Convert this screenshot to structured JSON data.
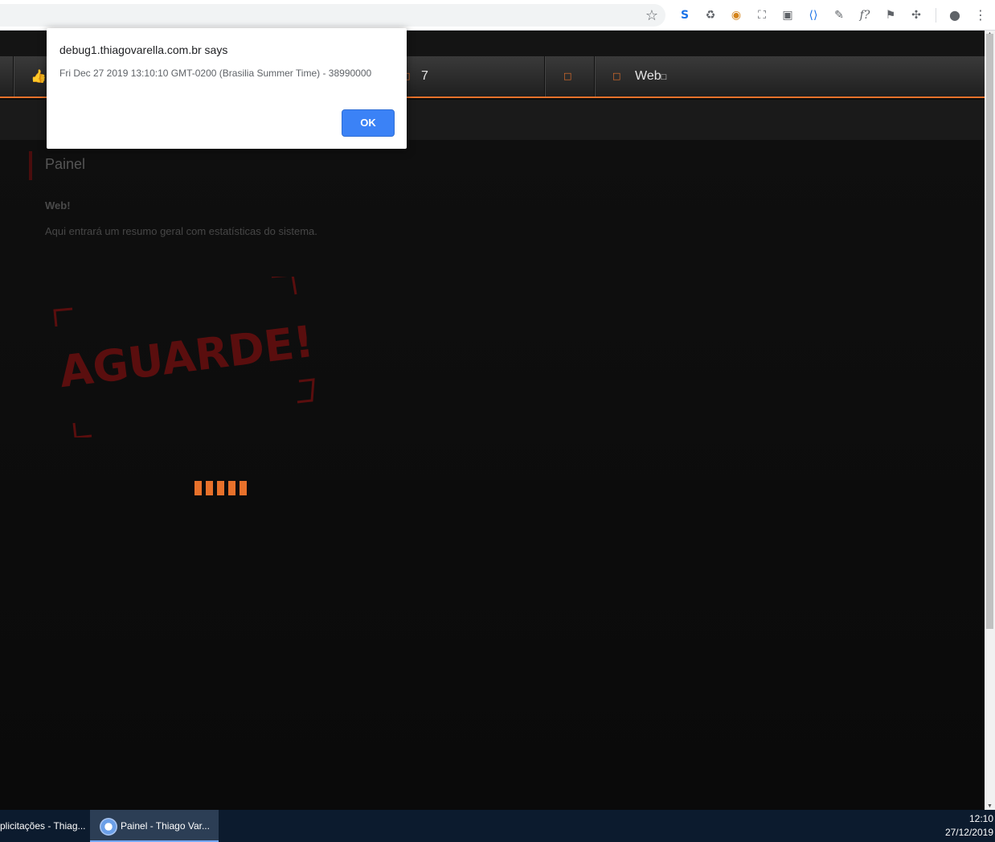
{
  "browser": {
    "extensions": [
      "star-icon",
      "s-extension-icon",
      "recycle-icon",
      "basketball-icon",
      "screenshot-icon",
      "reader-icon",
      "code-icon",
      "eyedropper-icon",
      "font-icon",
      "flag-icon",
      "puzzle-icon",
      "account-icon",
      "menu-icon"
    ]
  },
  "nav": {
    "item1_count": "",
    "item2_count": "7",
    "web_label": "Web"
  },
  "content": {
    "title": "Painel",
    "subtitle": "Web!",
    "description": "Aqui entrará um resumo geral com estatísticas do sistema.",
    "stamp_text": "AGUARDE!"
  },
  "dialog": {
    "title": "debug1.thiagovarella.com.br says",
    "message": "Fri Dec 27 2019 13:10:10 GMT-0200 (Brasilia Summer Time) - 38990000",
    "ok_label": "OK"
  },
  "taskbar": {
    "tasks": [
      {
        "label": "plicitações - Thiag..."
      },
      {
        "label": "Painel - Thiago Var..."
      }
    ],
    "time": "12:10",
    "date": "27/12/2019"
  },
  "colors": {
    "accent": "#e8712b",
    "dialog_button": "#3b82f6",
    "stamp": "#5a0e0e"
  }
}
